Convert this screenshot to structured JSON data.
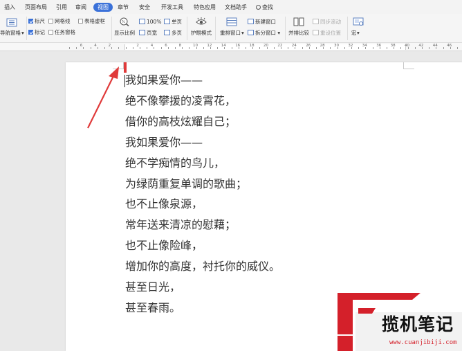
{
  "tabs": [
    "插入",
    "页面布局",
    "引用",
    "审阅",
    "视图",
    "章节",
    "安全",
    "开发工具",
    "特色应用",
    "文档助手",
    "查找"
  ],
  "ribbon": {
    "nav_pane": "导航窗格",
    "ruler": "标尺",
    "gridlines": "网格线",
    "table_borders": "表格虚框",
    "marks": "标记",
    "task_pane": "任务窗格",
    "zoom": "显示比例",
    "zoom_100": "100%",
    "page_width": "页宽",
    "single_page": "单页",
    "multi_page": "多页",
    "eye_mode": "护眼模式",
    "arrange_window": "重排窗口",
    "new_window": "新建窗口",
    "split_window": "拆分窗口",
    "side_by_side": "并排比较",
    "sync_scroll": "同步滚动",
    "reset_position": "重设位置",
    "macro": "宏"
  },
  "ruler_numbers": [
    "6",
    "4",
    "2",
    "2",
    "4",
    "6",
    "8",
    "10",
    "12",
    "14",
    "16",
    "18",
    "20",
    "22",
    "24",
    "26",
    "28",
    "30",
    "32",
    "34",
    "36",
    "38",
    "40",
    "42",
    "44",
    "46"
  ],
  "document_lines": [
    "我如果爱你——",
    "绝不像攀援的凌霄花，",
    "借你的高枝炫耀自己；",
    "我如果爱你——",
    "绝不学痴情的鸟儿，",
    "为绿荫重复单调的歌曲；",
    "也不止像泉源，",
    "常年送来清凉的慰藉；",
    "也不止像险峰，",
    "增加你的高度，衬托你的威仪。",
    "甚至日光，",
    "甚至春雨。"
  ],
  "watermark": {
    "text": "揽机笔记",
    "url": "www.cuanjibiji.com"
  },
  "colors": {
    "accent": "#3a71d9",
    "arrow": "#e03a3a",
    "watermark_red": "#d4202a"
  }
}
